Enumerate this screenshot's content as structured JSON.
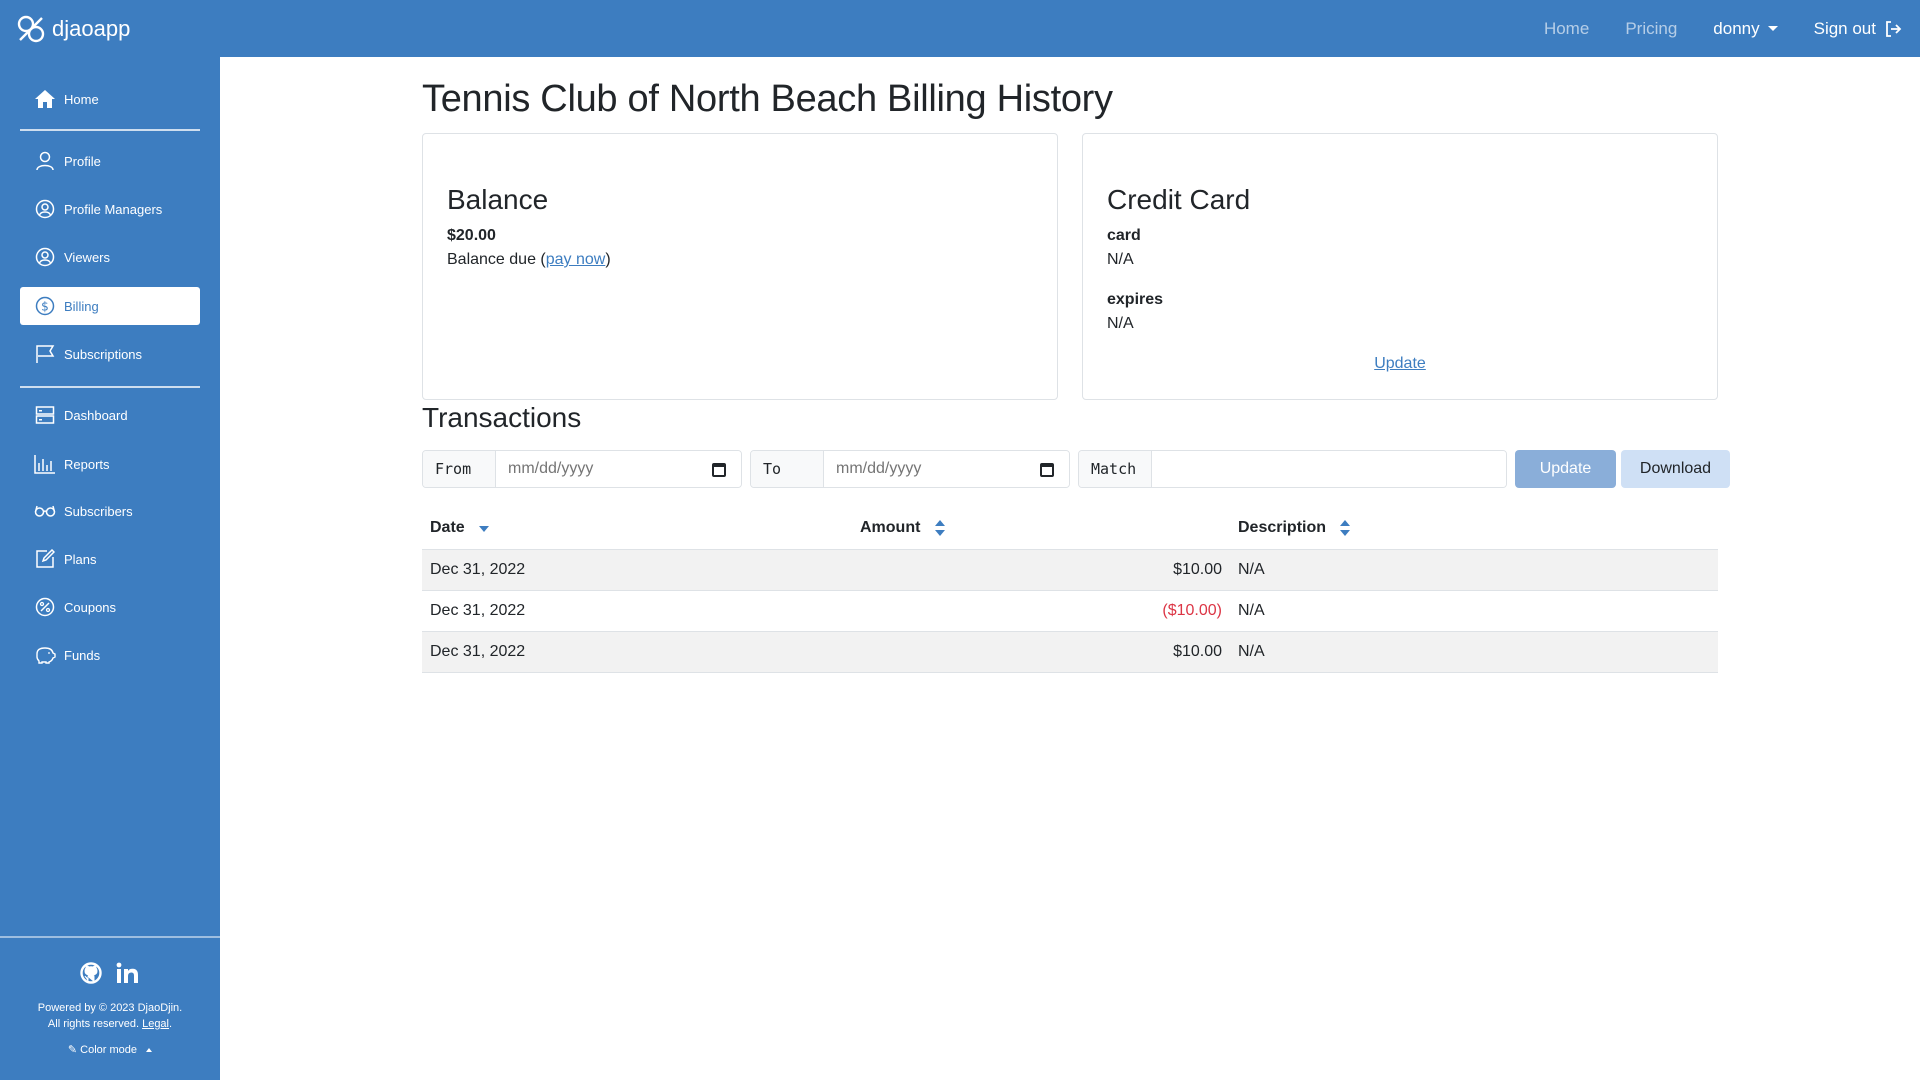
{
  "brand": {
    "name": "djaoapp"
  },
  "topnav": {
    "home": "Home",
    "pricing": "Pricing",
    "user": "donny",
    "signout": "Sign out"
  },
  "sidebar": {
    "items": [
      {
        "label": "Home",
        "icon": "home-icon"
      },
      {
        "label": "Profile",
        "icon": "user-icon"
      },
      {
        "label": "Profile Managers",
        "icon": "user-circle-icon"
      },
      {
        "label": "Viewers",
        "icon": "user-circle-icon"
      },
      {
        "label": "Billing",
        "icon": "dollar-icon",
        "active": true
      },
      {
        "label": "Subscriptions",
        "icon": "flag-icon"
      },
      {
        "label": "Dashboard",
        "icon": "server-icon"
      },
      {
        "label": "Reports",
        "icon": "chart-icon"
      },
      {
        "label": "Subscribers",
        "icon": "glasses-icon"
      },
      {
        "label": "Plans",
        "icon": "edit-icon"
      },
      {
        "label": "Coupons",
        "icon": "percent-icon"
      },
      {
        "label": "Funds",
        "icon": "piggy-bank-icon"
      }
    ],
    "footer": {
      "powered": "Powered by © 2023 DjaoDjin.",
      "rights": "All rights reserved.",
      "legal": "Legal",
      "color_mode": "Color mode"
    }
  },
  "page": {
    "title": "Tennis Club of North Beach Billing History"
  },
  "balance": {
    "heading": "Balance",
    "amount": "$20.00",
    "due_text": "Balance due (",
    "pay_now": "pay now",
    "close_paren": ")"
  },
  "credit_card": {
    "heading": "Credit Card",
    "card_label": "card",
    "card_value": "N/A",
    "expires_label": "expires",
    "expires_value": "N/A",
    "update_link": "Update"
  },
  "transactions": {
    "heading": "Transactions",
    "from_label": "From",
    "to_label": "To",
    "match_label": "Match",
    "date_placeholder": "mm/dd/yyyy",
    "update_button": "Update",
    "download_button": "Download",
    "columns": [
      "Date",
      "Amount",
      "Description"
    ],
    "rows": [
      {
        "date": "Dec 31, 2022",
        "amount": "$10.00",
        "description": "N/A"
      },
      {
        "date": "Dec 31, 2022",
        "amount": "($10.00)",
        "description": "N/A"
      },
      {
        "date": "Dec 31, 2022",
        "amount": "$10.00",
        "description": "N/A"
      }
    ]
  },
  "colors": {
    "primary": "#3d7dc0",
    "negative": "#dc3545"
  }
}
